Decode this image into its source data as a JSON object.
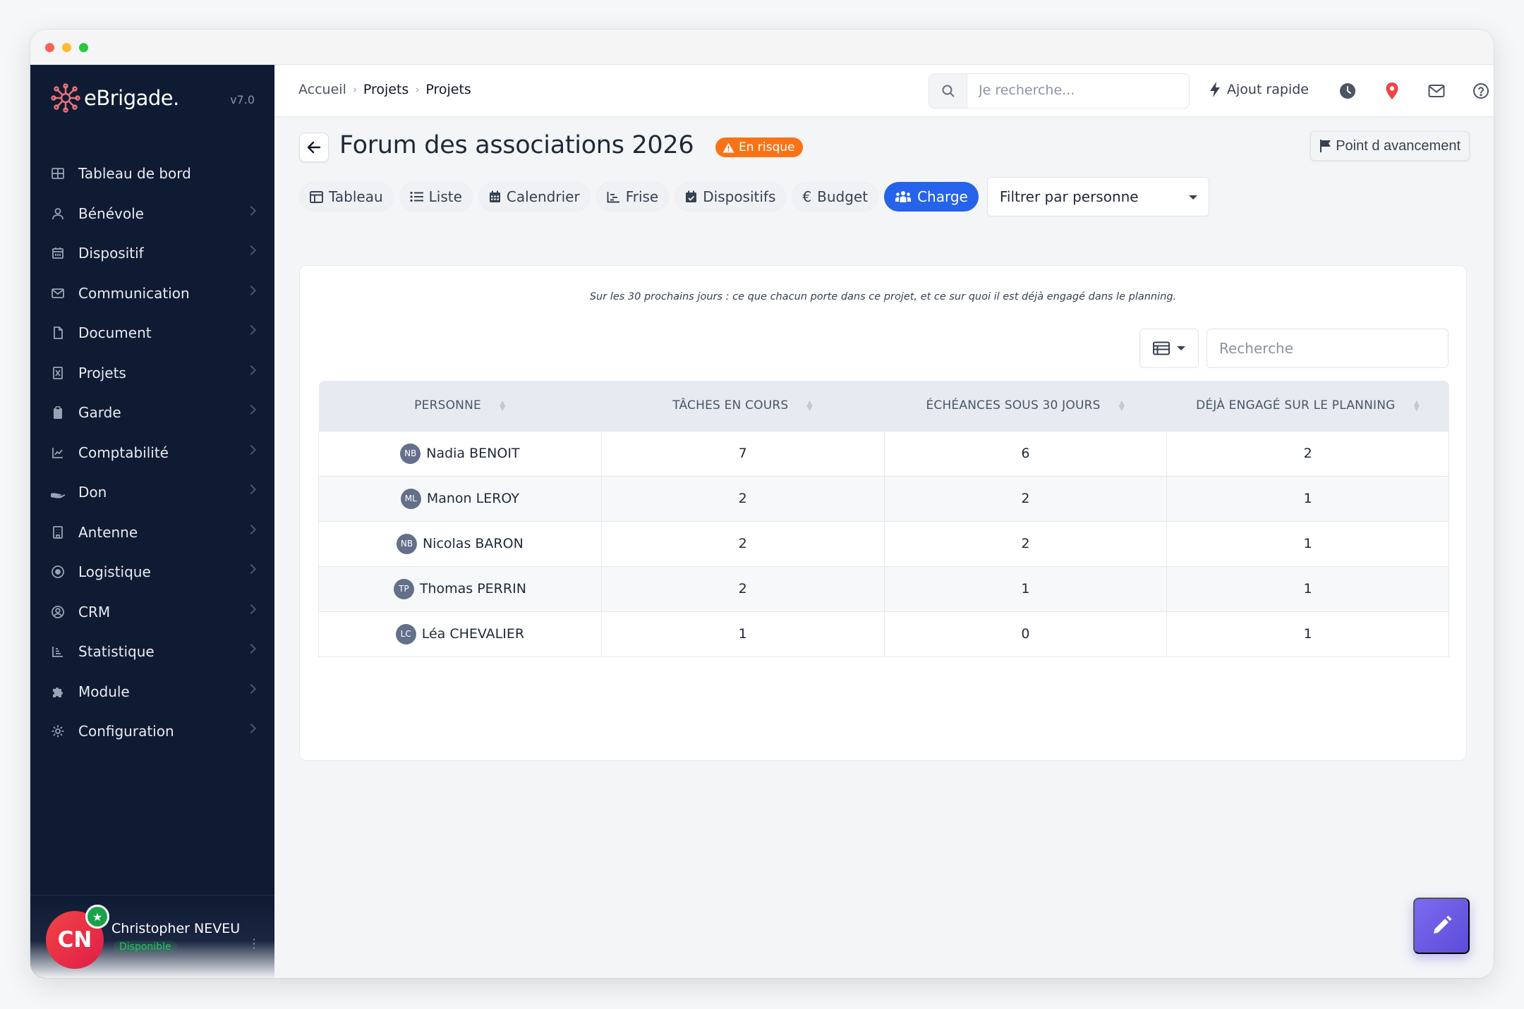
{
  "app": {
    "logo_text": "eBrigade.",
    "version": "v7.0"
  },
  "sidebar": {
    "items": [
      {
        "label": "Tableau de bord",
        "icon": "dashboard-icon",
        "chevron": false
      },
      {
        "label": "Bénévole",
        "icon": "user-icon",
        "chevron": true
      },
      {
        "label": "Dispositif",
        "icon": "calendar-grid-icon",
        "chevron": true
      },
      {
        "label": "Communication",
        "icon": "envelope-icon",
        "chevron": true
      },
      {
        "label": "Document",
        "icon": "file-icon",
        "chevron": true
      },
      {
        "label": "Projets",
        "icon": "project-icon",
        "chevron": true
      },
      {
        "label": "Garde",
        "icon": "clipboard-icon",
        "chevron": true
      },
      {
        "label": "Comptabilité",
        "icon": "line-chart-icon",
        "chevron": true
      },
      {
        "label": "Don",
        "icon": "hand-icon",
        "chevron": true
      },
      {
        "label": "Antenne",
        "icon": "building-icon",
        "chevron": true
      },
      {
        "label": "Logistique",
        "icon": "target-icon",
        "chevron": true
      },
      {
        "label": "CRM",
        "icon": "contact-icon",
        "chevron": true
      },
      {
        "label": "Statistique",
        "icon": "bar-chart-icon",
        "chevron": true
      },
      {
        "label": "Module",
        "icon": "puzzle-icon",
        "chevron": true
      },
      {
        "label": "Configuration",
        "icon": "gear-icon",
        "chevron": true
      }
    ],
    "user": {
      "initials": "CN",
      "name": "Christopher NEVEU",
      "status": "Disponible"
    }
  },
  "topbar": {
    "breadcrumb": [
      "Accueil",
      "Projets",
      "Projets"
    ],
    "search_placeholder": "Je recherche...",
    "quick_add_label": "Ajout rapide"
  },
  "page": {
    "title": "Forum des associations 2026",
    "status_badge": "En risque",
    "progress_button": "Point d avancement",
    "tabs": [
      {
        "label": "Tableau",
        "icon": "table-icon",
        "active": false
      },
      {
        "label": "Liste",
        "icon": "list-icon",
        "active": false
      },
      {
        "label": "Calendrier",
        "icon": "calendar-icon",
        "active": false
      },
      {
        "label": "Frise",
        "icon": "timeline-icon",
        "active": false
      },
      {
        "label": "Dispositifs",
        "icon": "calendar-check-icon",
        "active": false
      },
      {
        "label": "Budget",
        "icon": "euro-icon",
        "active": false
      },
      {
        "label": "Charge",
        "icon": "people-icon",
        "active": true
      }
    ],
    "filter_select": "Filtrer par personne"
  },
  "workload": {
    "caption": "Sur les 30 prochains jours : ce que chacun porte dans ce projet, et ce sur quoi il est déjà engagé dans le planning.",
    "search_placeholder": "Recherche",
    "columns": [
      "Personne",
      "Tâches en cours",
      "Échéances sous 30 jours",
      "Déjà engagé sur le planning"
    ],
    "rows": [
      {
        "initials": "NB",
        "name": "Nadia BENOIT",
        "tasks": "7",
        "deadlines": "6",
        "engaged": "2"
      },
      {
        "initials": "ML",
        "name": "Manon LEROY",
        "tasks": "2",
        "deadlines": "2",
        "engaged": "1"
      },
      {
        "initials": "NB",
        "name": "Nicolas BARON",
        "tasks": "2",
        "deadlines": "2",
        "engaged": "1"
      },
      {
        "initials": "TP",
        "name": "Thomas PERRIN",
        "tasks": "2",
        "deadlines": "1",
        "engaged": "1"
      },
      {
        "initials": "LC",
        "name": "Léa CHEVALIER",
        "tasks": "1",
        "deadlines": "0",
        "engaged": "1"
      }
    ]
  },
  "colors": {
    "sidebar_bg": "#0f1b33",
    "accent": "#2563eb",
    "risk": "#f97316",
    "fab": "#6a5ae0"
  }
}
